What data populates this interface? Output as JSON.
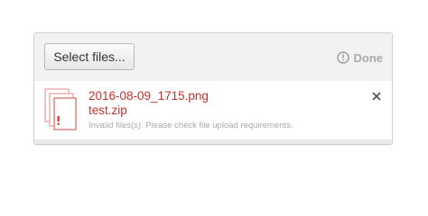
{
  "toolbar": {
    "select_label": "Select files...",
    "done_label": "Done"
  },
  "file": {
    "names": [
      "2016-08-09_1715.png",
      "test.zip"
    ],
    "error": "Invalid files(s). Please check file upload requirements.",
    "status_icon": "error-document-icon"
  },
  "colors": {
    "error": "#c9302c",
    "muted": "#a9a9a9",
    "toolbar_bg": "#f2f2f2"
  }
}
